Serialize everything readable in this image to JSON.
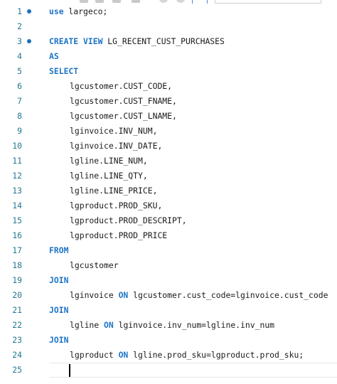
{
  "colors": {
    "keyword": "#1e74c6",
    "text": "#1a1a1a",
    "line_number": "#237893",
    "breakpoint_marker": "#1f6fbf",
    "current_line_border": "#e6e6e6"
  },
  "editor": {
    "lines": [
      {
        "no": "1",
        "marker": true,
        "indent": false,
        "tokens": [
          [
            "kw",
            "use"
          ],
          [
            "txt",
            " largeco;"
          ]
        ]
      },
      {
        "no": "2",
        "marker": false,
        "indent": false,
        "tokens": []
      },
      {
        "no": "3",
        "marker": true,
        "indent": false,
        "tokens": [
          [
            "kw",
            "CREATE VIEW"
          ],
          [
            "txt",
            " LG_RECENT_CUST_PURCHASES"
          ]
        ]
      },
      {
        "no": "4",
        "marker": false,
        "indent": false,
        "tokens": [
          [
            "kw",
            "AS"
          ]
        ]
      },
      {
        "no": "5",
        "marker": false,
        "indent": false,
        "tokens": [
          [
            "kw",
            "SELECT"
          ]
        ]
      },
      {
        "no": "6",
        "marker": false,
        "indent": true,
        "tokens": [
          [
            "txt",
            "lgcustomer.CUST_CODE,"
          ]
        ]
      },
      {
        "no": "7",
        "marker": false,
        "indent": true,
        "tokens": [
          [
            "txt",
            "lgcustomer.CUST_FNAME,"
          ]
        ]
      },
      {
        "no": "8",
        "marker": false,
        "indent": true,
        "tokens": [
          [
            "txt",
            "lgcustomer.CUST_LNAME,"
          ]
        ]
      },
      {
        "no": "9",
        "marker": false,
        "indent": true,
        "tokens": [
          [
            "txt",
            "lginvoice.INV_NUM,"
          ]
        ]
      },
      {
        "no": "10",
        "marker": false,
        "indent": true,
        "tokens": [
          [
            "txt",
            "lginvoice.INV_DATE,"
          ]
        ]
      },
      {
        "no": "11",
        "marker": false,
        "indent": true,
        "tokens": [
          [
            "txt",
            "lgline.LINE_NUM,"
          ]
        ]
      },
      {
        "no": "12",
        "marker": false,
        "indent": true,
        "tokens": [
          [
            "txt",
            "lgline.LINE_QTY,"
          ]
        ]
      },
      {
        "no": "13",
        "marker": false,
        "indent": true,
        "tokens": [
          [
            "txt",
            "lgline.LINE_PRICE,"
          ]
        ]
      },
      {
        "no": "14",
        "marker": false,
        "indent": true,
        "tokens": [
          [
            "txt",
            "lgproduct.PROD_SKU,"
          ]
        ]
      },
      {
        "no": "15",
        "marker": false,
        "indent": true,
        "tokens": [
          [
            "txt",
            "lgproduct.PROD_DESCRIPT,"
          ]
        ]
      },
      {
        "no": "16",
        "marker": false,
        "indent": true,
        "tokens": [
          [
            "txt",
            "lgproduct.PROD_PRICE"
          ]
        ]
      },
      {
        "no": "17",
        "marker": false,
        "indent": false,
        "tokens": [
          [
            "kw",
            "FROM"
          ]
        ]
      },
      {
        "no": "18",
        "marker": false,
        "indent": true,
        "tokens": [
          [
            "txt",
            "lgcustomer"
          ]
        ]
      },
      {
        "no": "19",
        "marker": false,
        "indent": false,
        "tokens": [
          [
            "kw",
            "JOIN"
          ]
        ]
      },
      {
        "no": "20",
        "marker": false,
        "indent": true,
        "tokens": [
          [
            "txt",
            "lginvoice "
          ],
          [
            "kw",
            "ON"
          ],
          [
            "txt",
            " lgcustomer.cust_code=lginvoice.cust_code"
          ]
        ]
      },
      {
        "no": "21",
        "marker": false,
        "indent": false,
        "tokens": [
          [
            "kw",
            "JOIN"
          ]
        ]
      },
      {
        "no": "22",
        "marker": false,
        "indent": true,
        "tokens": [
          [
            "txt",
            "lgline "
          ],
          [
            "kw",
            "ON"
          ],
          [
            "txt",
            " lginvoice.inv_num=lgline.inv_num"
          ]
        ]
      },
      {
        "no": "23",
        "marker": false,
        "indent": false,
        "tokens": [
          [
            "kw",
            "JOIN"
          ]
        ]
      },
      {
        "no": "24",
        "marker": false,
        "indent": true,
        "tokens": [
          [
            "txt",
            "lgproduct "
          ],
          [
            "kw",
            "ON"
          ],
          [
            "txt",
            " lgline.prod_sku=lgproduct.prod_sku;"
          ]
        ]
      },
      {
        "no": "25",
        "marker": false,
        "indent": false,
        "current": true,
        "tokens": []
      }
    ]
  }
}
